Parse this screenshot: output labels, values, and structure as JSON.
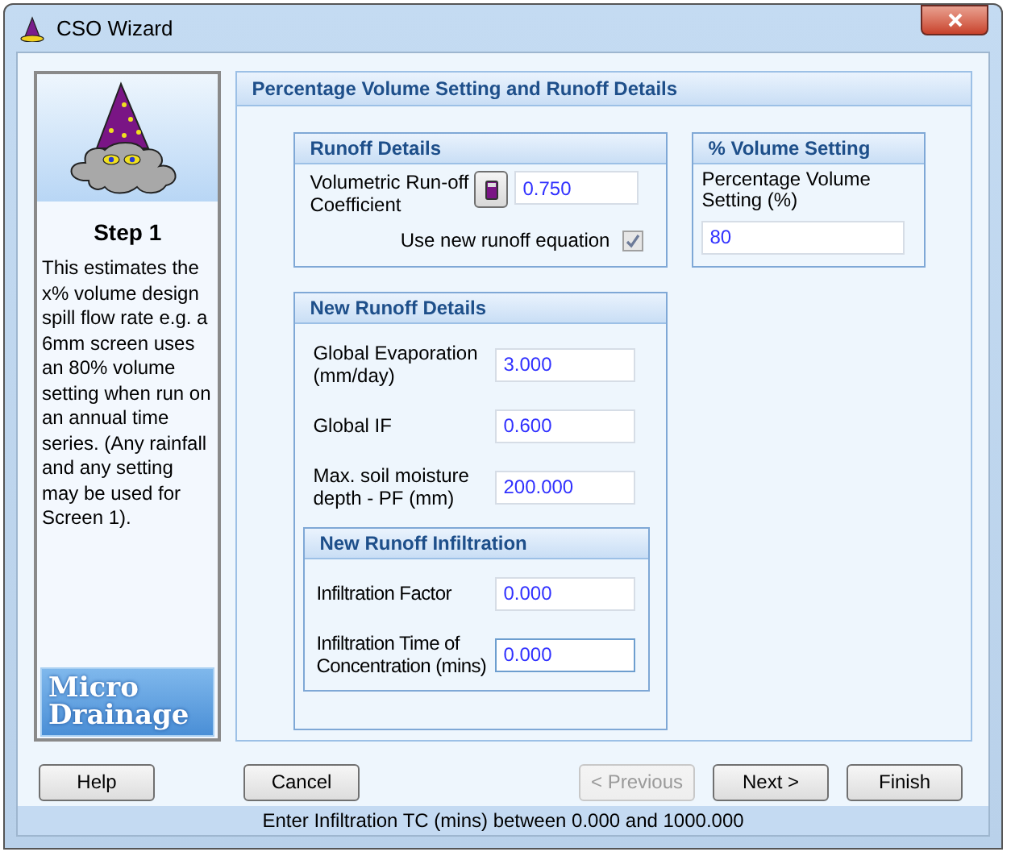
{
  "window": {
    "title": "CSO Wizard"
  },
  "sidebar": {
    "step_title": "Step 1",
    "description": "This estimates the x% volume design spill flow rate e.g. a 6mm screen uses an 80% volume setting when run on an annual time series.  (Any rainfall and any setting may be used for Screen 1).",
    "logo": [
      "Micro",
      "Drainage"
    ]
  },
  "page": {
    "title": "Percentage Volume Setting and Runoff Details",
    "runoff_details": {
      "title": "Runoff Details",
      "coefficient": {
        "label": "Volumetric Run-off Coefficient",
        "value": "0.750"
      },
      "checkbox": {
        "label": "Use new runoff equation",
        "checked": true,
        "disabled": true
      }
    },
    "volume_setting": {
      "title": "% Volume Setting",
      "label": "Percentage Volume Setting (%)",
      "value": "80"
    },
    "new_runoff_details": {
      "title": "New Runoff Details",
      "fields": [
        {
          "label": "Global Evaporation (mm/day)",
          "value": "3.000"
        },
        {
          "label": "Global IF",
          "value": "0.600"
        },
        {
          "label": "Max. soil moisture depth - PF (mm)",
          "value": "200.000"
        }
      ]
    },
    "new_runoff_infiltration": {
      "title": "New Runoff Infiltration",
      "fields": [
        {
          "label": "Infiltration Factor",
          "value": "0.000",
          "focused": false
        },
        {
          "label": "Infiltration Time of Concentration (mins)",
          "value": "0.000",
          "focused": true
        }
      ]
    }
  },
  "buttons": [
    {
      "label": "Help",
      "disabled": false
    },
    {
      "label": "Cancel",
      "disabled": false
    },
    {
      "label": "< Previous",
      "disabled": true
    },
    {
      "label": "Next >",
      "disabled": false
    },
    {
      "label": "Finish",
      "disabled": false
    }
  ],
  "status_bar": "Enter Infiltration TC (mins) between 0.000 and 1000.000"
}
